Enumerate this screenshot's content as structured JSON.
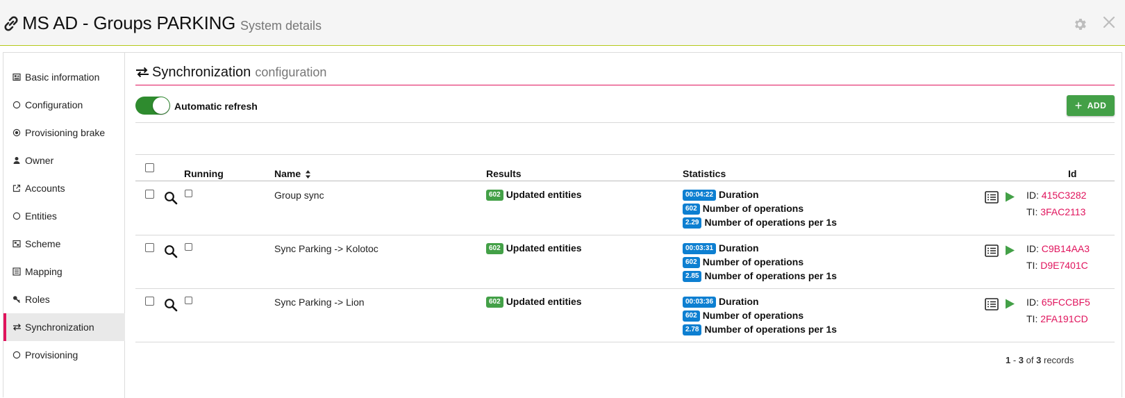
{
  "header": {
    "title": "MS AD - Groups PARKING",
    "subtitle": "System details",
    "link_icon": "link-icon",
    "settings_icon": "gear-icon",
    "close_icon": "close-icon"
  },
  "sidebar": {
    "items": [
      {
        "label": "Basic information",
        "icon": "newspaper-icon"
      },
      {
        "label": "Configuration",
        "icon": "circle-icon"
      },
      {
        "label": "Provisioning brake",
        "icon": "record-icon"
      },
      {
        "label": "Owner",
        "icon": "person-icon"
      },
      {
        "label": "Accounts",
        "icon": "external-link-icon"
      },
      {
        "label": "Entities",
        "icon": "circle-icon"
      },
      {
        "label": "Scheme",
        "icon": "scheme-icon"
      },
      {
        "label": "Mapping",
        "icon": "list-icon"
      },
      {
        "label": "Roles",
        "icon": "key-icon"
      },
      {
        "label": "Synchronization",
        "icon": "exchange-icon",
        "active": true
      },
      {
        "label": "Provisioning",
        "icon": "circle-icon"
      }
    ],
    "accent_color": "#e0135c"
  },
  "section": {
    "title": "Synchronization",
    "subtitle": "configuration"
  },
  "toolbar": {
    "auto_refresh_label": "Automatic refresh",
    "auto_refresh_on": true,
    "add_label": "ADD"
  },
  "table": {
    "headers": {
      "running": "Running",
      "name": "Name",
      "results": "Results",
      "statistics": "Statistics",
      "id": "Id"
    },
    "rows": [
      {
        "name": "Group sync",
        "result_count": "602",
        "result_label": "Updated entities",
        "duration": "00:04:22",
        "duration_label": "Duration",
        "operations": "602",
        "operations_label": "Number of operations",
        "rate": "2.29",
        "rate_label": "Number of operations per 1s",
        "id_prefix": "ID:",
        "id": "415C3282",
        "ti_prefix": "TI:",
        "ti": "3FAC2113"
      },
      {
        "name": "Sync Parking -> Kolotoc",
        "result_count": "602",
        "result_label": "Updated entities",
        "duration": "00:03:31",
        "duration_label": "Duration",
        "operations": "602",
        "operations_label": "Number of operations",
        "rate": "2.85",
        "rate_label": "Number of operations per 1s",
        "id_prefix": "ID:",
        "id": "C9B14AA3",
        "ti_prefix": "TI:",
        "ti": "D9E7401C"
      },
      {
        "name": "Sync Parking -> Lion",
        "result_count": "602",
        "result_label": "Updated entities",
        "duration": "00:03:36",
        "duration_label": "Duration",
        "operations": "602",
        "operations_label": "Number of operations",
        "rate": "2.78",
        "rate_label": "Number of operations per 1s",
        "id_prefix": "ID:",
        "id": "65FCCBF5",
        "ti_prefix": "TI:",
        "ti": "2FA191CD"
      }
    ],
    "pagination": {
      "from": "1",
      "to": "3",
      "of_label": "of",
      "total": "3",
      "records_label": "records"
    }
  },
  "colors": {
    "success": "#43a047",
    "info": "#0d7fd1",
    "accent": "#e0135c",
    "header_rule": "#b5c91a"
  }
}
